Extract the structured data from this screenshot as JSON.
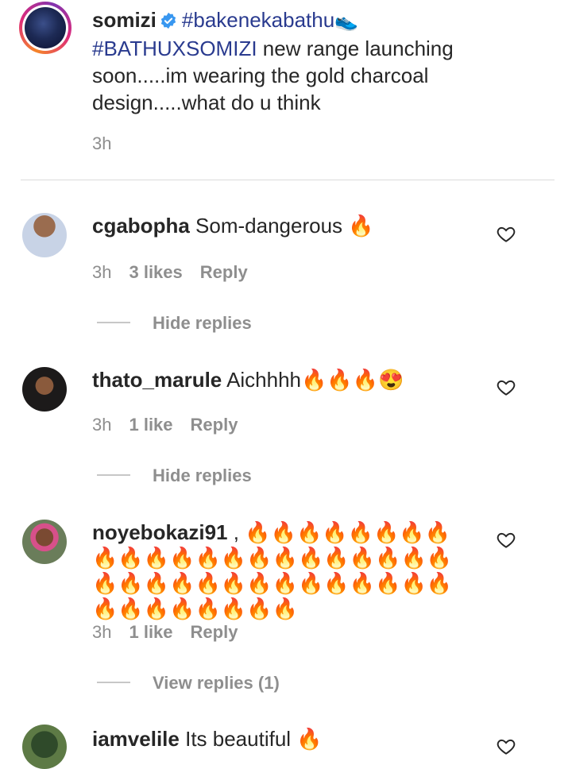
{
  "caption": {
    "username": "somizi",
    "hashtag1": "#bakenekabathu",
    "shoe": "👟",
    "hashtag2": "#BATHUXSOMIZI",
    "text": " new range launching soon.....im wearing the gold charcoal design.....what do u think",
    "time": "3h"
  },
  "comments": [
    {
      "username": "cgabopha",
      "text": "Som-dangerous 🔥",
      "time": "3h",
      "likes": "3 likes",
      "reply": "Reply",
      "toggle": "Hide replies"
    },
    {
      "username": "thato_marule",
      "text": "Aichhhh🔥🔥🔥😍",
      "time": "3h",
      "likes": "1 like",
      "reply": "Reply",
      "toggle": "Hide replies"
    },
    {
      "username": "noyebokazi91",
      "text": ", 🔥🔥🔥🔥🔥🔥🔥🔥🔥🔥🔥🔥🔥🔥🔥🔥🔥🔥🔥🔥🔥🔥🔥🔥🔥🔥🔥🔥🔥🔥🔥🔥🔥🔥🔥🔥🔥🔥🔥🔥🔥🔥🔥🔥",
      "time": "3h",
      "likes": "1 like",
      "reply": "Reply",
      "toggle": "View replies (1)"
    },
    {
      "username": "iamvelile",
      "text": "Its beautiful 🔥"
    }
  ],
  "colors": {
    "hashtag": "#2a3b8f",
    "muted": "#8e8e8e",
    "verified": "#3897f0"
  }
}
